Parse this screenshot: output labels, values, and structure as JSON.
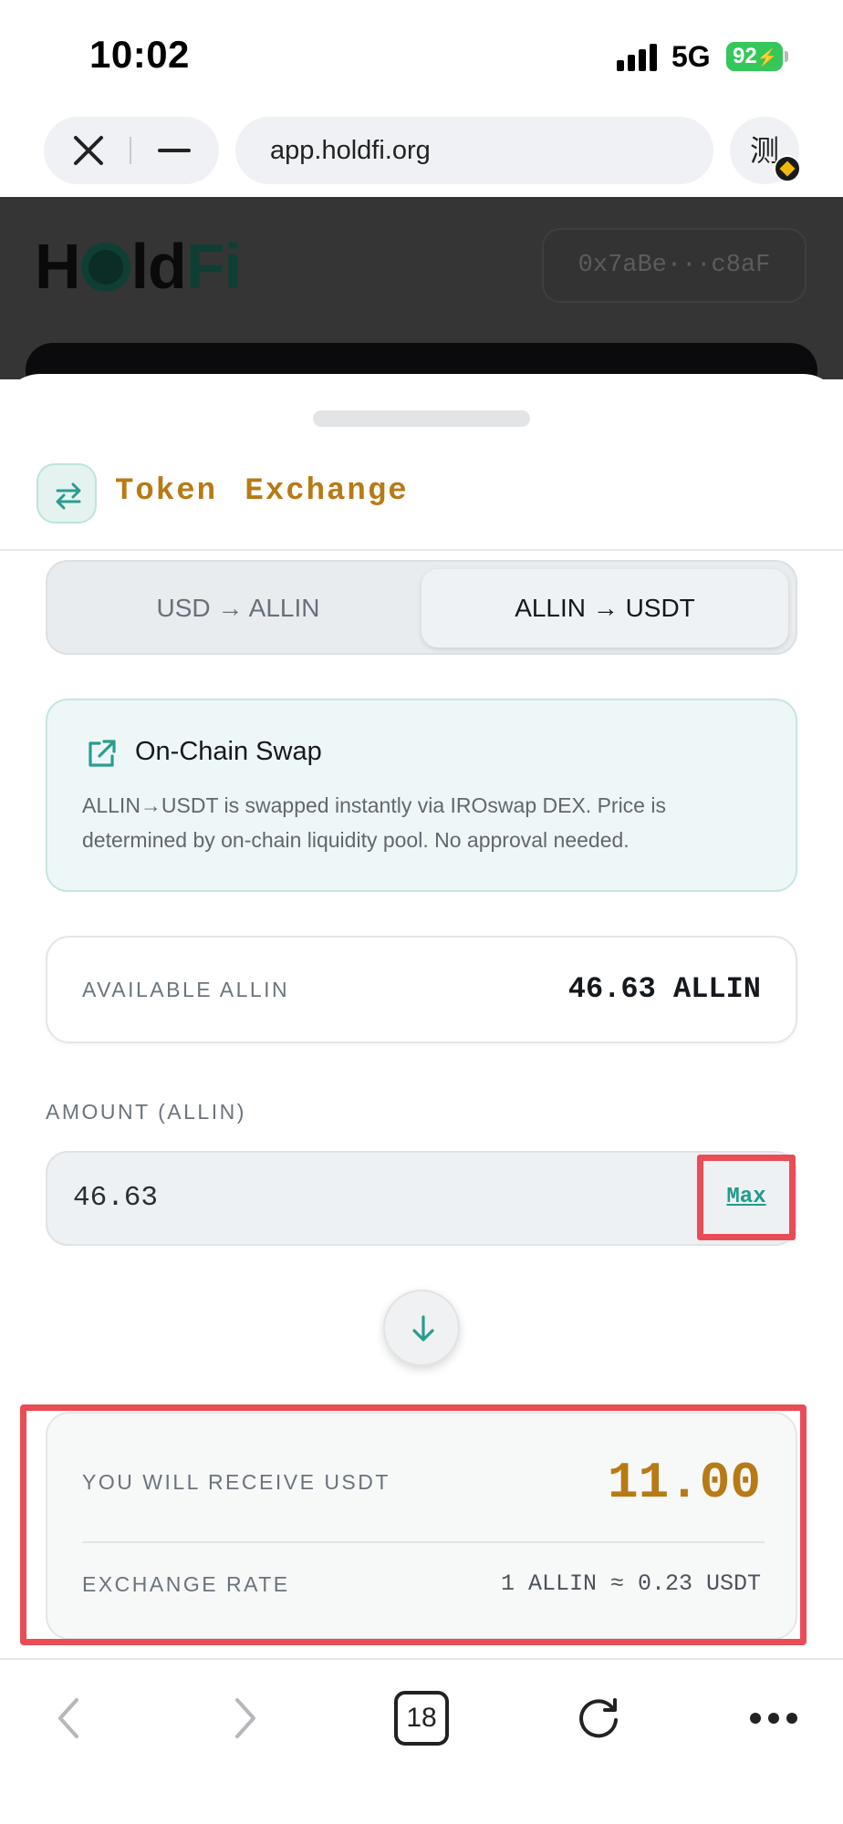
{
  "status_bar": {
    "time": "10:02",
    "network": "5G",
    "battery": "92"
  },
  "browser": {
    "url": "app.holdfi.org",
    "extension_label": "测"
  },
  "background_page": {
    "logo": "HoldFi",
    "logo_parts": {
      "h": "H",
      "ld": "ld",
      "fi": "Fi"
    },
    "wallet": "0x7aBe···c8aF"
  },
  "sheet": {
    "title": "Token Exchange",
    "tabs": [
      {
        "label": "USD → ALLIN",
        "active": false
      },
      {
        "label": "ALLIN → USDT",
        "active": true
      }
    ],
    "info": {
      "title": "On-Chain Swap",
      "text": "ALLIN→USDT is swapped instantly via IROswap DEX. Price is determined by on-chain liquidity pool. No approval needed."
    },
    "available": {
      "label": "AVAILABLE ALLIN",
      "value": "46.63 ALLIN"
    },
    "amount": {
      "label": "AMOUNT (ALLIN)",
      "value": "46.63",
      "max_label": "Max"
    },
    "receive": {
      "label": "YOU WILL RECEIVE USDT",
      "value": "11.00",
      "rate_label": "EXCHANGE RATE",
      "rate_value": "1 ALLIN ≈ 0.23 USDT"
    }
  },
  "toolbar": {
    "tab_count": "18"
  },
  "colors": {
    "accent_gold": "#b87a14",
    "accent_teal": "#1f9d8c",
    "highlight_red": "#ea4c55",
    "battery_green": "#34c759"
  },
  "icons": [
    "close-icon",
    "minimize-icon",
    "exchange-icon",
    "external-link-icon",
    "arrow-down-icon",
    "back-icon",
    "forward-icon",
    "reload-icon",
    "more-icon"
  ]
}
